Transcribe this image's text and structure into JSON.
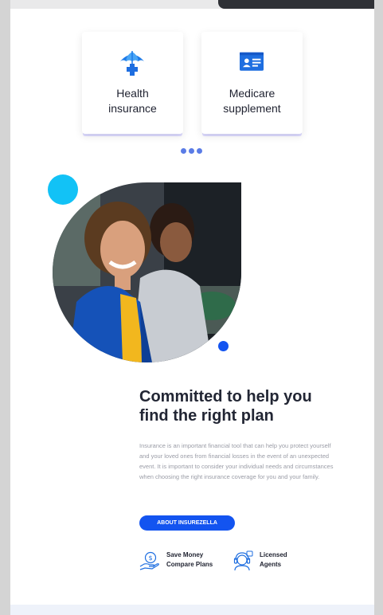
{
  "cards": [
    {
      "icon": "umbrella-medical-icon",
      "label_line1": "Health",
      "label_line2": "insurance"
    },
    {
      "icon": "id-card-icon",
      "label_line1": "Medicare",
      "label_line2": "supplement"
    }
  ],
  "carousel": {
    "dots": 3
  },
  "about": {
    "title_line1": "Committed to help you",
    "title_line2": "find the right plan",
    "description": "Insurance is an important financial tool that can help you protect yourself and your loved ones from financial losses in the event of an unexpected event. It is important to consider your individual needs and circumstances when choosing the right insurance coverage for you and your family.",
    "button_label": "ABOUT INSUREZELLA"
  },
  "features": [
    {
      "icon": "money-hand-icon",
      "line1": "Save Money",
      "line2": "Compare Plans"
    },
    {
      "icon": "support-agent-icon",
      "line1": "Licensed",
      "line2": "Agents"
    }
  ],
  "colors": {
    "accent": "#1354f0",
    "cyan": "#12c2f6",
    "heading": "#222634",
    "muted": "#9a9ca6"
  }
}
